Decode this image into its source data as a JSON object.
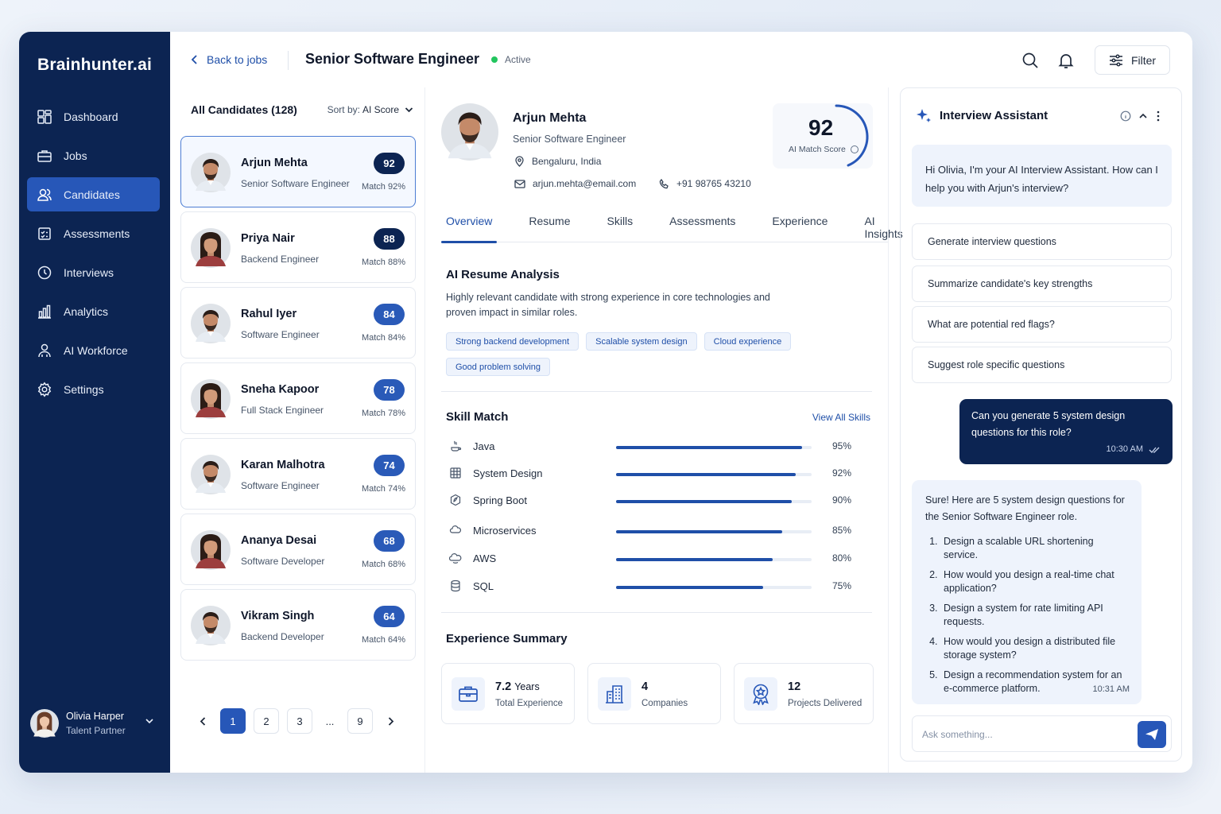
{
  "app": {
    "logo": "Brainhunter.ai"
  },
  "sidebar": {
    "items": [
      {
        "label": "Dashboard",
        "icon": "dashboard-icon"
      },
      {
        "label": "Jobs",
        "icon": "briefcase-icon"
      },
      {
        "label": "Candidates",
        "icon": "users-icon",
        "active": true
      },
      {
        "label": "Assessments",
        "icon": "checklist-icon"
      },
      {
        "label": "Interviews",
        "icon": "clock-icon"
      },
      {
        "label": "Analytics",
        "icon": "bar-chart-icon"
      },
      {
        "label": "AI Workforce",
        "icon": "team-icon"
      },
      {
        "label": "Settings",
        "icon": "gear-icon"
      }
    ],
    "user": {
      "name": "Olivia Harper",
      "role": "Talent Partner"
    }
  },
  "header": {
    "back_label": "Back to jobs",
    "job_title": "Senior Software Engineer",
    "status": "Active",
    "filter_label": "Filter"
  },
  "candidates": {
    "heading": "All Candidates (128)",
    "sort_prefix": "Sort by:",
    "sort_value": "AI Score",
    "list": [
      {
        "name": "Arjun Mehta",
        "role": "Senior Software Engineer",
        "score": "92",
        "match": "Match 92%"
      },
      {
        "name": "Priya Nair",
        "role": "Backend Engineer",
        "score": "88",
        "match": "Match 88%"
      },
      {
        "name": "Rahul Iyer",
        "role": "Software Engineer",
        "score": "84",
        "match": "Match 84%"
      },
      {
        "name": "Sneha Kapoor",
        "role": "Full Stack Engineer",
        "score": "78",
        "match": "Match 78%"
      },
      {
        "name": "Karan Malhotra",
        "role": "Software Engineer",
        "score": "74",
        "match": "Match 74%"
      },
      {
        "name": "Ananya Desai",
        "role": "Software Developer",
        "score": "68",
        "match": "Match 68%"
      },
      {
        "name": "Vikram Singh",
        "role": "Backend Developer",
        "score": "64",
        "match": "Match 64%"
      }
    ],
    "pagination": [
      "1",
      "2",
      "3",
      "...",
      "9"
    ]
  },
  "profile": {
    "name": "Arjun Mehta",
    "role": "Senior Software Engineer",
    "location": "Bengaluru, India",
    "email": "arjun.mehta@email.com",
    "phone": "+91 98765 43210",
    "score": "92",
    "score_label": "AI Match Score",
    "score_fraction": 0.92,
    "tabs": [
      "Overview",
      "Resume",
      "Skills",
      "Assessments",
      "Experience",
      "AI Insights"
    ],
    "analysis_title": "AI Resume Analysis",
    "analysis_text": "Highly relevant candidate with strong experience in core technologies and proven impact in similar roles.",
    "chips": [
      "Strong backend development",
      "Scalable system design",
      "Cloud experience",
      "Good problem solving"
    ],
    "skill_title": "Skill Match",
    "view_all": "View All Skills",
    "skills": [
      {
        "name": "Java",
        "pct": "95%",
        "value": 95
      },
      {
        "name": "System Design",
        "pct": "92%",
        "value": 92
      },
      {
        "name": "Spring Boot",
        "pct": "90%",
        "value": 90
      },
      {
        "name": "Microservices",
        "pct": "85%",
        "value": 85
      },
      {
        "name": "AWS",
        "pct": "80%",
        "value": 80
      },
      {
        "name": "SQL",
        "pct": "75%",
        "value": 75
      }
    ],
    "exp_title": "Experience Summary",
    "experience": [
      {
        "value": "7.2",
        "unit": "Years",
        "label": "Total Experience"
      },
      {
        "value": "4",
        "unit": "",
        "label": "Companies"
      },
      {
        "value": "12",
        "unit": "",
        "label": "Projects Delivered"
      }
    ]
  },
  "assistant": {
    "title": "Interview Assistant",
    "greeting": "Hi Olivia, I'm your AI Interview Assistant. How can I help you with Arjun's interview?",
    "suggestions": [
      "Generate interview questions",
      "Summarize candidate's key strengths",
      "What are potential red flags?",
      "Suggest role specific questions"
    ],
    "user_message": "Can you generate 5 system design questions for this role?",
    "user_time": "10:30 AM",
    "reply_intro": "Sure! Here are 5 system design questions for the Senior Software Engineer role.",
    "reply_items": [
      "Design a scalable URL shortening service.",
      "How would you design a real-time chat application?",
      "Design a system for rate limiting API requests.",
      "How would you design a distributed file storage system?",
      "Design a recommendation system for an e-commerce platform."
    ],
    "reply_time": "10:31 AM",
    "input_placeholder": "Ask something..."
  },
  "colors": {
    "navy": "#0c2452",
    "accent": "#2757b8",
    "active_status": "#22c55e"
  }
}
